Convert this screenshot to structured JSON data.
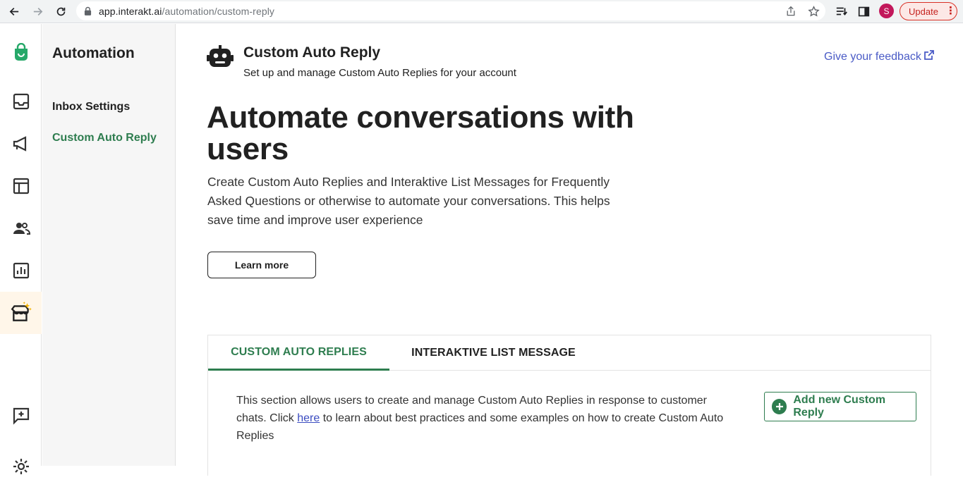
{
  "browser": {
    "url_host": "app.interakt.ai",
    "url_path": "/automation/custom-reply",
    "profile_initial": "S",
    "update_label": "Update",
    "update_menu": "⋮"
  },
  "rail": {
    "items": [
      "logo-icon",
      "inbox-icon",
      "campaign-icon",
      "template-icon",
      "contacts-icon",
      "analytics-icon",
      "automation-icon",
      "feedback-icon",
      "settings-icon"
    ],
    "active": "automation-icon",
    "brand_color": "#26a869"
  },
  "subnav": {
    "title": "Automation",
    "links": [
      {
        "label": "Inbox Settings",
        "active": false
      },
      {
        "label": "Custom Auto Reply",
        "active": true
      }
    ],
    "active_color": "#2e7d4f"
  },
  "header": {
    "title": "Custom Auto Reply",
    "subtitle": "Set up and manage Custom Auto Replies for your account",
    "feedback_label": "Give your feedback"
  },
  "hero": {
    "heading": "Automate conversations with users",
    "description": "Create Custom Auto Replies and Interaktive List Messages for Frequently Asked Questions or otherwise to automate your conversations. This helps save time and improve user experience",
    "learn_more_label": "Learn more"
  },
  "tabs": [
    {
      "label": "CUSTOM AUTO REPLIES",
      "active": true
    },
    {
      "label": "INTERAKTIVE LIST MESSAGE",
      "active": false
    }
  ],
  "section": {
    "text_before": "This section allows users to create and manage Custom Auto Replies in response to customer chats. Click ",
    "link_label": "here",
    "text_after": " to learn about best practices and some examples on how to create Custom Auto Replies",
    "add_button_label": "Add new Custom Reply"
  }
}
